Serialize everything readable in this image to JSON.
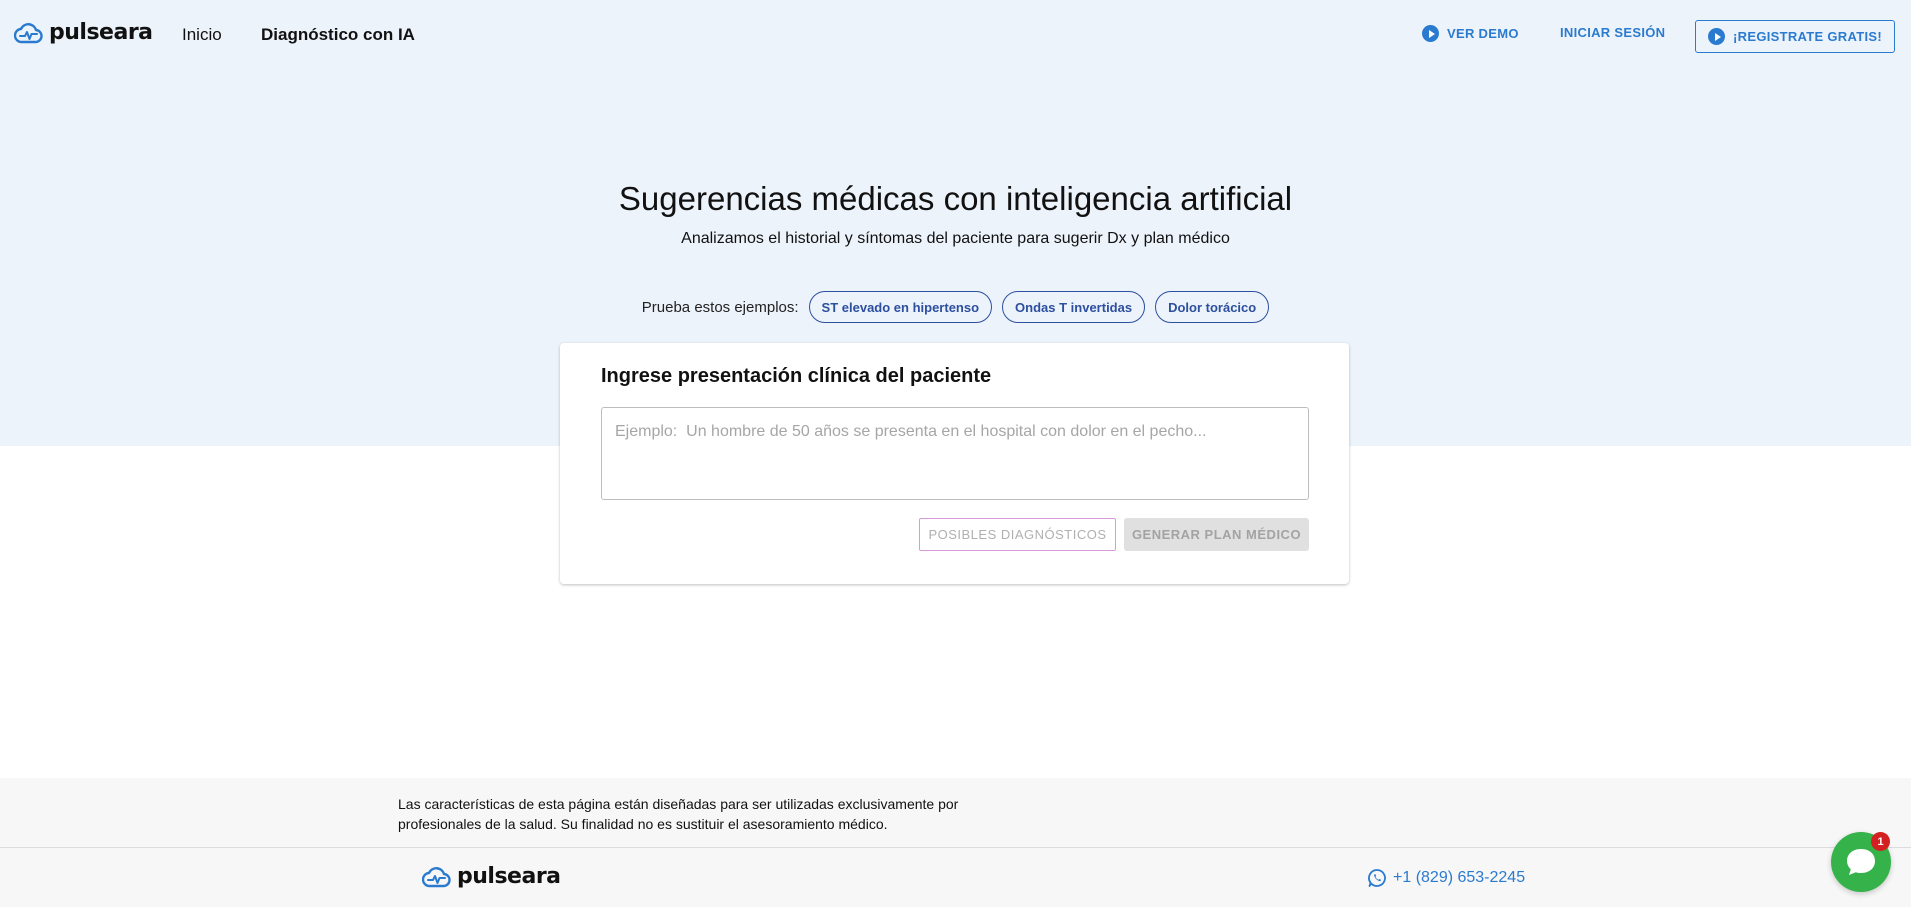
{
  "brand": {
    "name": "pulseara"
  },
  "nav": {
    "inicio": "Inicio",
    "diagnostico": "Diagnóstico con IA"
  },
  "header_actions": {
    "demo": "VER DEMO",
    "login": "INICIAR SESIÓN",
    "register": "¡REGISTRATE GRATIS!"
  },
  "hero": {
    "title": "Sugerencias médicas con inteligencia artificial",
    "subtitle": "Analizamos el historial y síntomas del paciente para sugerir Dx y plan médico"
  },
  "examples": {
    "label": "Prueba estos ejemplos:",
    "chips": [
      "ST elevado en hipertenso",
      "Ondas T invertidas",
      "Dolor torácico"
    ]
  },
  "card": {
    "title": "Ingrese presentación clínica del paciente",
    "placeholder": "Ejemplo:  Un hombre de 50 años se presenta en el hospital con dolor en el pecho...",
    "value": "",
    "btn_dx": "POSIBLES DIAGNÓSTICOS",
    "btn_plan": "GENERAR PLAN MÉDICO"
  },
  "footer": {
    "disclaimer": "Las características de esta página están diseñadas para ser utilizadas exclusivamente por profesionales de la salud. Su finalidad no es sustituir el asesoramiento médico.",
    "phone": "+1 (829) 653-2245"
  },
  "chat": {
    "badge": "1"
  },
  "colors": {
    "accent": "#2a7bd0",
    "chip": "#2c4f9e",
    "hero_bg": "#edf3fb",
    "chat": "#35b34a",
    "badge": "#d32020"
  }
}
